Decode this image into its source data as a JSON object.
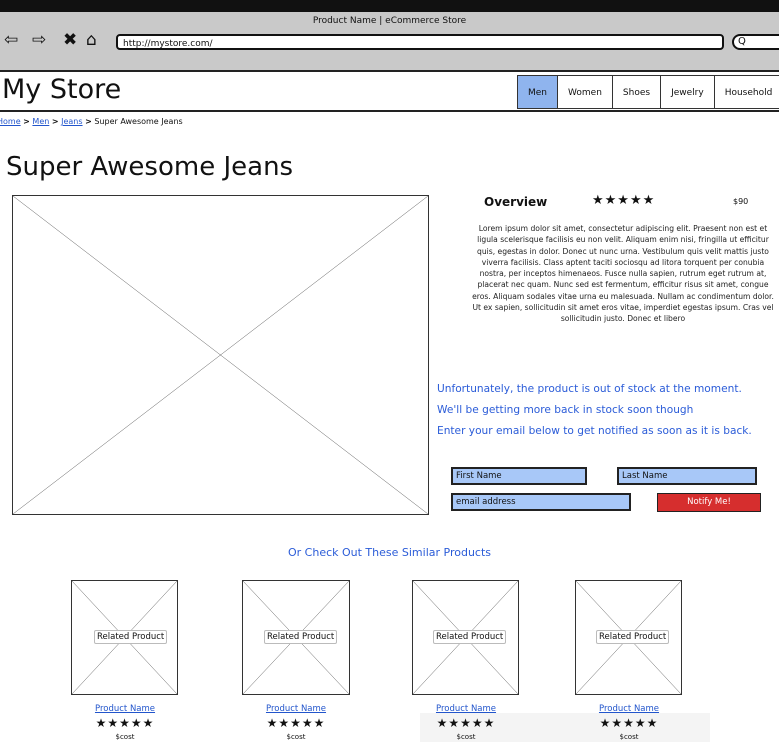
{
  "browser": {
    "window_title": "Product Name | eCommerce Store",
    "url": "http://mystore.com/",
    "search_glyph": "Q",
    "nav_icons": [
      "back-arrow-icon",
      "forward-arrow-icon",
      "stop-icon",
      "home-icon"
    ]
  },
  "header": {
    "store_title": "My Store",
    "tabs": [
      {
        "label": "Men",
        "active": true
      },
      {
        "label": "Women",
        "active": false
      },
      {
        "label": "Shoes",
        "active": false
      },
      {
        "label": "Jewelry",
        "active": false
      },
      {
        "label": "Household",
        "active": false
      }
    ]
  },
  "breadcrumb": {
    "home": "Home",
    "men": "Men",
    "jeans": "Jeans",
    "current": "Super Awesome Jeans",
    "separator": ">"
  },
  "product": {
    "title": "Super Awesome Jeans",
    "overview_heading": "Overview",
    "rating": "★★★★★",
    "price": "$90",
    "description": "Lorem ipsum dolor sit amet, consectetur adipiscing elit. Praesent non est et ligula scelerisque facilisis eu non velit. Aliquam enim nisi, fringilla ut efficitur quis, egestas in dolor. Donec ut nunc urna. Vestibulum quis velit mattis justo viverra facilisis. Class aptent taciti sociosqu ad litora torquent per conubia nostra, per inceptos himenaeos. Fusce nulla sapien, rutrum eget rutrum at, placerat nec quam. Nunc sed est fermentum, efficitur risus sit amet, congue eros. Aliquam sodales vitae urna eu malesuada. Nullam ac condimentum dolor. Ut ex sapien, sollicitudin sit amet eros vitae, imperdiet egestas ipsum. Cras vel sollicitudin justo. Donec et libero"
  },
  "stock_notice": {
    "line1": "Unfortunately, the product is out of stock at the moment.",
    "line2": "We'll be getting more back in stock soon though",
    "line3": "Enter your email below to get notified as soon as it is back."
  },
  "form": {
    "first_name": "First Name",
    "last_name": "Last Name",
    "email": "email address",
    "notify_label": "Notify Me!"
  },
  "similar": {
    "heading": "Or Check Out These Similar Products",
    "items": [
      {
        "image_label": "Related Product",
        "name": "Product Name",
        "rating": "★★★★★",
        "cost": "$cost"
      },
      {
        "image_label": "Related Product",
        "name": "Product Name",
        "rating": "★★★★★",
        "cost": "$cost"
      },
      {
        "image_label": "Related Product",
        "name": "Product Name",
        "rating": "★★★★★",
        "cost": "$cost"
      },
      {
        "image_label": "Related Product",
        "name": "Product Name",
        "rating": "★★★★★",
        "cost": "$cost"
      }
    ]
  },
  "colors": {
    "accent_blue": "#2b5cd8",
    "active_tab": "#8fb4ee",
    "input_fill": "#a8c8f8",
    "notify_red": "#d62e2e"
  }
}
